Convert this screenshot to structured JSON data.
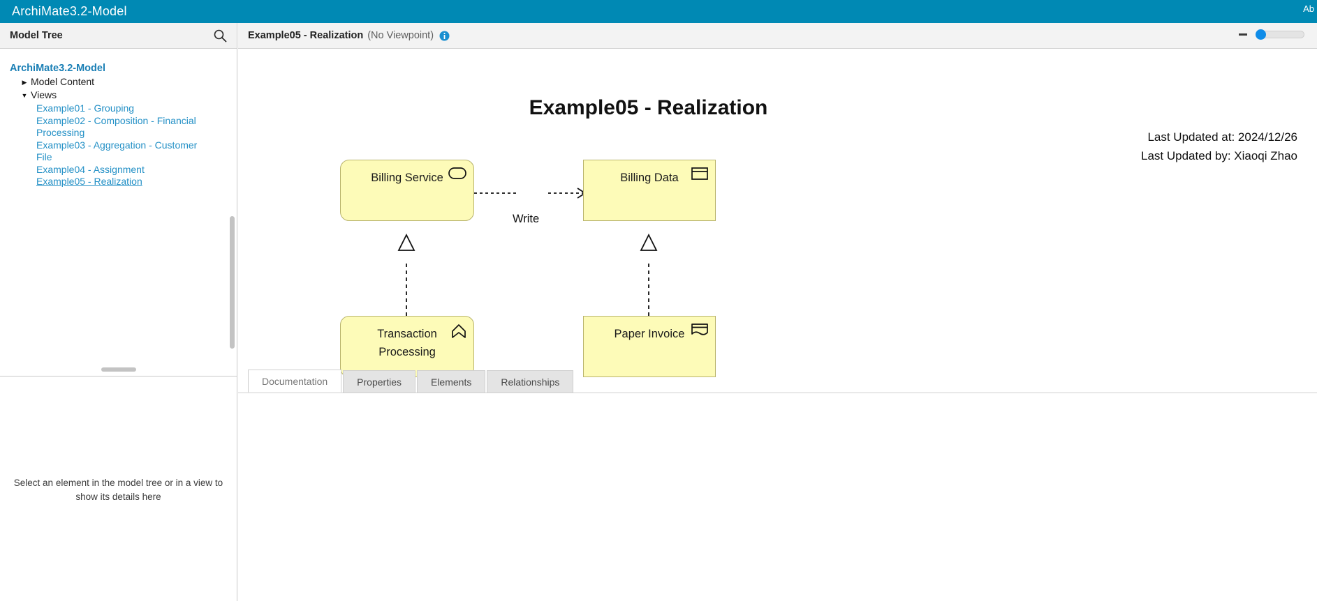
{
  "titlebar": {
    "title": "ArchiMate3.2-Model",
    "right_label": "Ab"
  },
  "sidebar": {
    "header": "Model Tree",
    "search_icon": "search-icon",
    "tree": {
      "root": "ArchiMate3.2-Model",
      "nodes": [
        {
          "label": "Model Content",
          "twisty": "▶",
          "expanded": false
        },
        {
          "label": "Views",
          "twisty": "▼",
          "expanded": true
        }
      ],
      "views": [
        {
          "label": "Example01 - Grouping",
          "selected": false
        },
        {
          "label": "Example02 - Composition - Financial Processing",
          "selected": false
        },
        {
          "label": "Example03 - Aggregation - Customer File",
          "selected": false
        },
        {
          "label": "Example04 - Assignment",
          "selected": false
        },
        {
          "label": "Example05 - Realization",
          "selected": true
        }
      ]
    },
    "details_placeholder": "Select an element in the model tree or in a view to show its details here"
  },
  "view": {
    "title": "Example05 - Realization",
    "subtitle": "(No Viewpoint)",
    "info_icon": "info-icon",
    "zoom": {
      "minus_label": "−",
      "value": 0
    }
  },
  "diagram": {
    "title": "Example05 - Realization",
    "metadata": {
      "updated_at": "Last Updated at: 2024/12/26",
      "updated_by": "Last Updated by: Xiaoqi Zhao"
    },
    "nodes": [
      {
        "id": "billing-service",
        "label": "Billing Service",
        "icon": "application-service-icon",
        "shape": "rounded"
      },
      {
        "id": "billing-data",
        "label": "Billing Data",
        "icon": "data-object-icon",
        "shape": "rect"
      },
      {
        "id": "transaction-processing",
        "label": "Transaction Processing",
        "icon": "application-function-icon",
        "shape": "rounded"
      },
      {
        "id": "paper-invoice",
        "label": "Paper Invoice",
        "icon": "representation-icon",
        "shape": "rect"
      }
    ],
    "edges": [
      {
        "id": "write",
        "label": "Write",
        "type": "access"
      },
      {
        "id": "realization-service",
        "label": "",
        "type": "realization"
      },
      {
        "id": "realization-data",
        "label": "",
        "type": "realization"
      }
    ],
    "colors": {
      "node_fill": "#fdfbb8",
      "node_border": "#b9b46d",
      "accent": "#0089b4"
    }
  },
  "tabs": [
    {
      "label": "Documentation",
      "active": true
    },
    {
      "label": "Properties",
      "active": false
    },
    {
      "label": "Elements",
      "active": false
    },
    {
      "label": "Relationships",
      "active": false
    }
  ]
}
